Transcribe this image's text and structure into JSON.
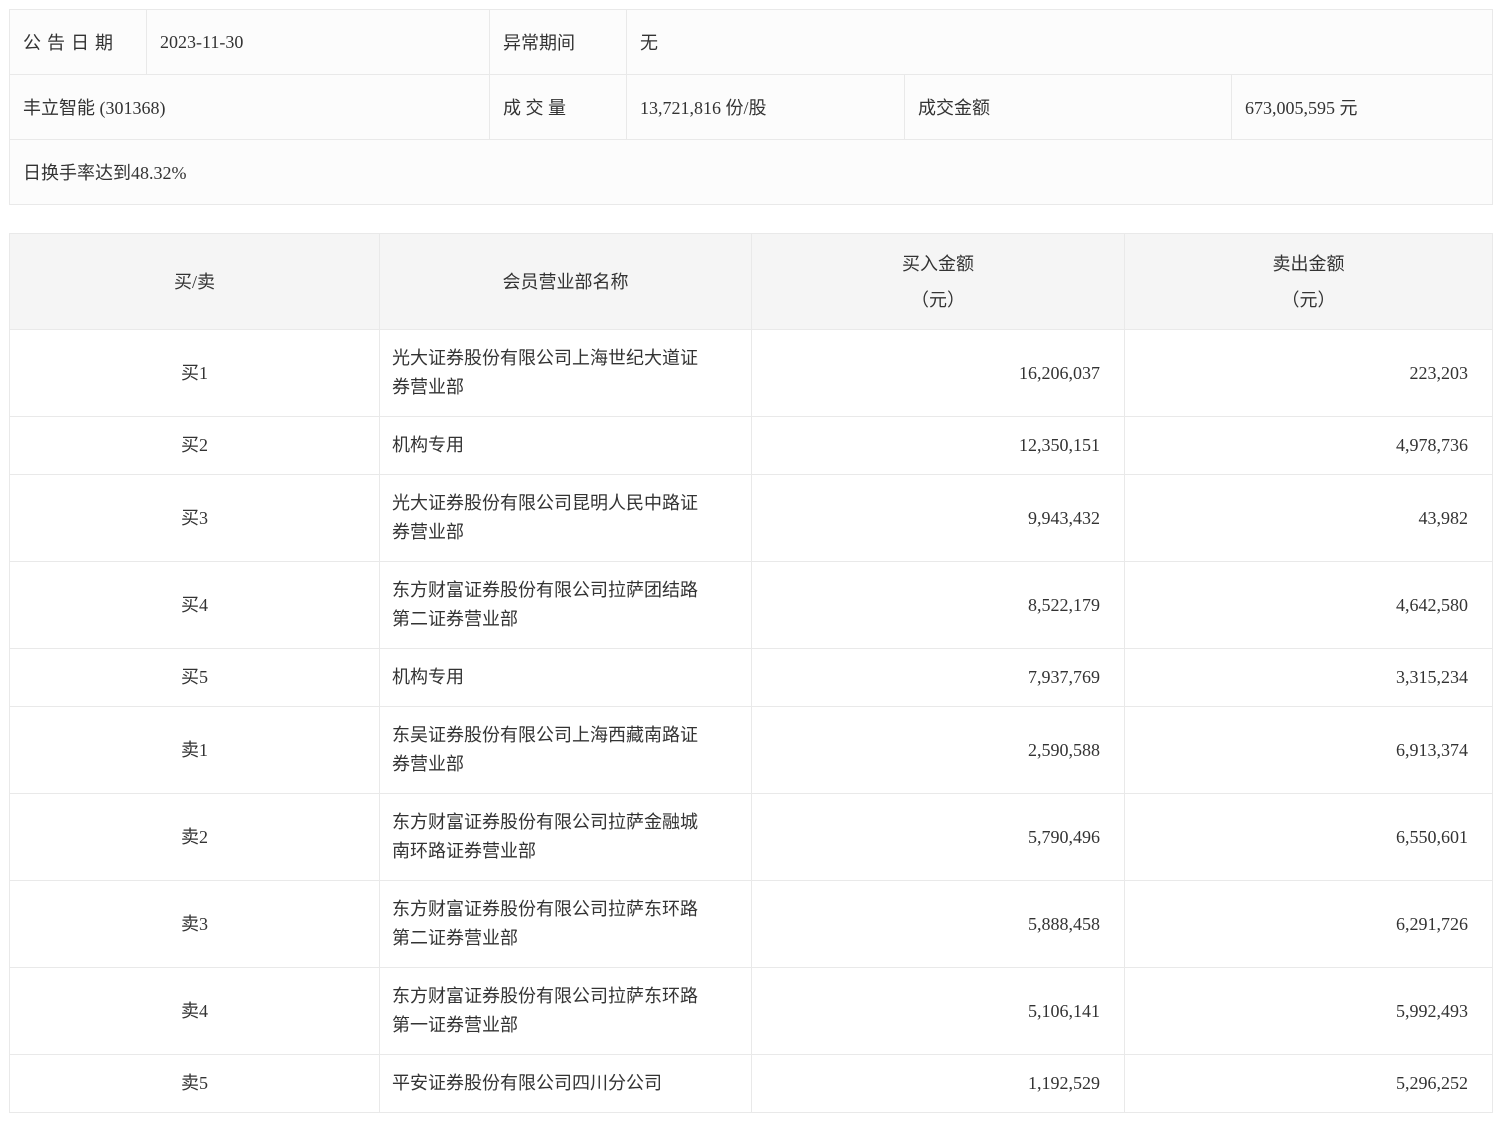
{
  "info": {
    "announce_date_label": "公告日期",
    "announce_date": "2023-11-30",
    "abnormal_period_label": "异常期间",
    "abnormal_period": "无",
    "stock_name": "丰立智能 (301368)",
    "volume_label": "成 交 量",
    "volume_value": "13,721,816 份/股",
    "turnover_label": "成交金额",
    "turnover_value": "673,005,595 元",
    "note": "日换手率达到48.32%"
  },
  "table": {
    "headers": {
      "side": "买/卖",
      "branch": "会员营业部名称",
      "buy_line1": "买入金额",
      "buy_line2": "（元）",
      "sell_line1": "卖出金额",
      "sell_line2": "（元）"
    },
    "rows": [
      {
        "side": "买1",
        "name": "光大证券股份有限公司上海世纪大道证券营业部",
        "buy": "16,206,037",
        "sell": "223,203"
      },
      {
        "side": "买2",
        "name": "机构专用",
        "buy": "12,350,151",
        "sell": "4,978,736"
      },
      {
        "side": "买3",
        "name": "光大证券股份有限公司昆明人民中路证券营业部",
        "buy": "9,943,432",
        "sell": "43,982"
      },
      {
        "side": "买4",
        "name": "东方财富证券股份有限公司拉萨团结路第二证券营业部",
        "buy": "8,522,179",
        "sell": "4,642,580"
      },
      {
        "side": "买5",
        "name": "机构专用",
        "buy": "7,937,769",
        "sell": "3,315,234"
      },
      {
        "side": "卖1",
        "name": "东吴证券股份有限公司上海西藏南路证券营业部",
        "buy": "2,590,588",
        "sell": "6,913,374"
      },
      {
        "side": "卖2",
        "name": "东方财富证券股份有限公司拉萨金融城南环路证券营业部",
        "buy": "5,790,496",
        "sell": "6,550,601"
      },
      {
        "side": "卖3",
        "name": "东方财富证券股份有限公司拉萨东环路第二证券营业部",
        "buy": "5,888,458",
        "sell": "6,291,726"
      },
      {
        "side": "卖4",
        "name": "东方财富证券股份有限公司拉萨东环路第一证券营业部",
        "buy": "5,106,141",
        "sell": "5,992,493"
      },
      {
        "side": "卖5",
        "name": "平安证券股份有限公司四川分公司",
        "buy": "1,192,529",
        "sell": "5,296,252"
      }
    ]
  }
}
